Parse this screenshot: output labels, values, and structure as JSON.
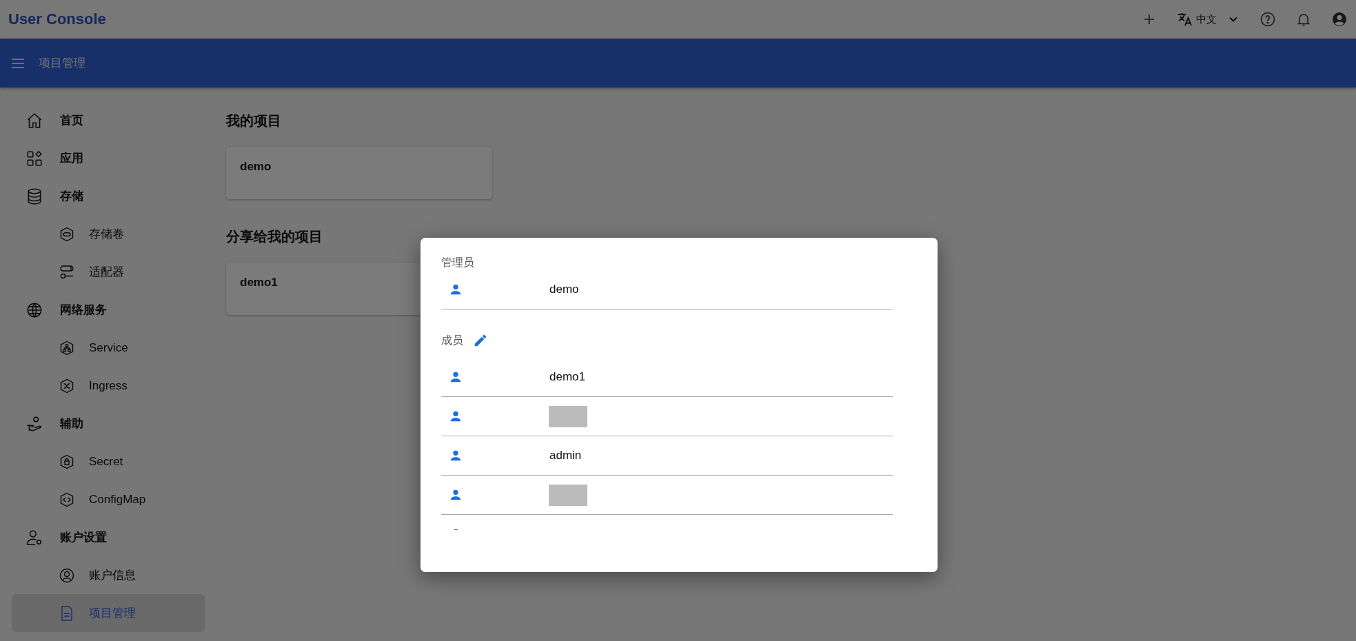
{
  "app": {
    "title": "User Console",
    "language": "中文"
  },
  "header": {
    "title": "项目管理"
  },
  "sidebar": {
    "items": [
      {
        "label": "首页",
        "selected": false
      },
      {
        "label": "应用",
        "selected": false
      },
      {
        "label": "存储",
        "selected": false,
        "children": [
          {
            "label": "存储卷",
            "selected": false
          },
          {
            "label": "适配器",
            "selected": false
          }
        ]
      },
      {
        "label": "网络服务",
        "selected": false,
        "children": [
          {
            "label": "Service",
            "selected": false
          },
          {
            "label": "Ingress",
            "selected": false
          }
        ]
      },
      {
        "label": "辅助",
        "selected": false,
        "children": [
          {
            "label": "Secret",
            "selected": false
          },
          {
            "label": "ConfigMap",
            "selected": false
          }
        ]
      },
      {
        "label": "账户设置",
        "selected": false,
        "children": [
          {
            "label": "账户信息",
            "selected": false
          },
          {
            "label": "项目管理",
            "selected": true
          }
        ]
      }
    ]
  },
  "sections": [
    {
      "title": "我的项目",
      "projects": [
        "demo"
      ]
    },
    {
      "title": "分享给我的项目",
      "projects": [
        "demo1"
      ]
    }
  ],
  "dialog": {
    "admin_label": "管理员",
    "admins": [
      {
        "kind": "named",
        "name": "demo"
      }
    ],
    "members_label": "成员",
    "members": [
      {
        "kind": "named",
        "name": "demo1"
      },
      {
        "kind": "redacted"
      },
      {
        "kind": "named",
        "name": "admin"
      },
      {
        "kind": "redacted"
      },
      {
        "kind": "clipped"
      }
    ]
  }
}
